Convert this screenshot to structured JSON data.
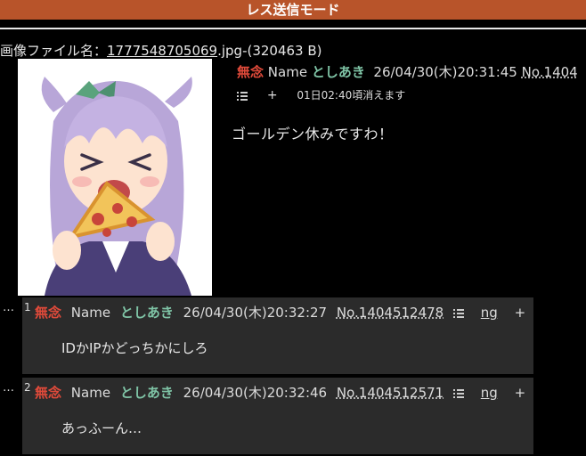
{
  "header": {
    "title": "レス送信モード"
  },
  "file_info": {
    "prefix": "画像ファイル名：",
    "filename": "1777548705069",
    "suffix": ".jpg-(320463 B)"
  },
  "op": {
    "subject": "無念",
    "name_label": "Name",
    "name": "としあき",
    "datetime": "26/04/30(木)20:31:45",
    "number": "No.1404",
    "plus": "+",
    "expire": "01日02:40頃消えます",
    "text": "ゴールデン休みですわ！"
  },
  "replies": [
    {
      "dots": "…",
      "index": "1",
      "subject": "無念",
      "name_label": "Name",
      "name": "としあき",
      "datetime": "26/04/30(木)20:32:27",
      "number": "No.1404512478",
      "ng": "ng",
      "plus": "+",
      "text": "IDかIPかどっちかにしろ"
    },
    {
      "dots": "…",
      "index": "2",
      "subject": "無念",
      "name_label": "Name",
      "name": "としあき",
      "datetime": "26/04/30(木)20:32:46",
      "number": "No.1404512571",
      "ng": "ng",
      "plus": "+",
      "text": "あっふーん…"
    }
  ],
  "colors": {
    "header_bg": "#b8542a",
    "subject": "#e04a3a",
    "name": "#7fc4a6",
    "reply_bg": "#2b2b2b"
  }
}
